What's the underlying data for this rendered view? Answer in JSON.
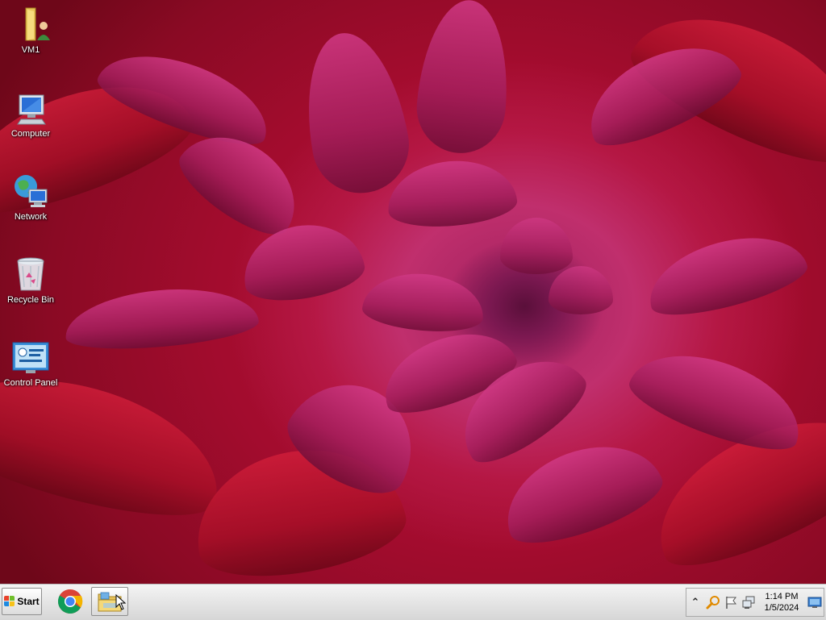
{
  "desktop": {
    "icons": [
      {
        "name": "vm1-folder",
        "label": "VM1",
        "icon": "user-folder-icon"
      },
      {
        "name": "computer",
        "label": "Computer",
        "icon": "computer-icon"
      },
      {
        "name": "network",
        "label": "Network",
        "icon": "network-icon"
      },
      {
        "name": "recycle-bin",
        "label": "Recycle Bin",
        "icon": "recycle-bin-icon"
      },
      {
        "name": "control-panel",
        "label": "Control Panel",
        "icon": "control-panel-icon"
      }
    ]
  },
  "taskbar": {
    "start_label": "Start",
    "pinned": [
      {
        "name": "chrome",
        "icon": "chrome-icon"
      },
      {
        "name": "file-explorer",
        "icon": "folder-icon",
        "active": true
      }
    ],
    "tray": {
      "overflow_glyph": "⌃",
      "icons": [
        "search-icon",
        "flag-icon",
        "network-status-icon"
      ],
      "time": "1:14 PM",
      "date": "1/5/2024"
    }
  },
  "colors": {
    "wallpaper_petal": "#c02f6d",
    "wallpaper_red": "#a80f27",
    "taskbar_bg": "#e2e2e2"
  }
}
